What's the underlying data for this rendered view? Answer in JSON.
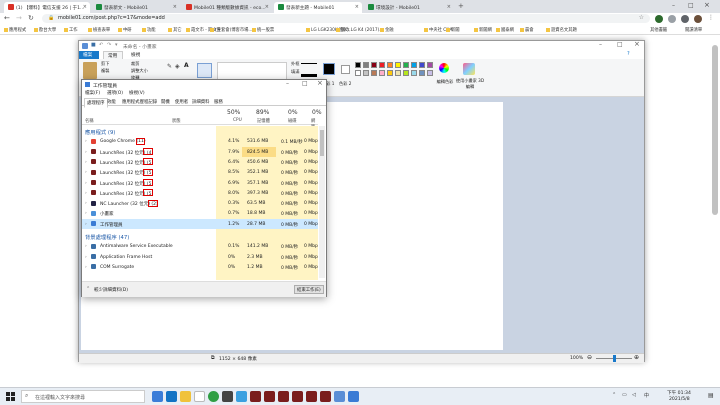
{
  "browser": {
    "tabs": [
      {
        "label": "(1) 【爆料】電信支援 26 | 于1...",
        "color": "#d93025"
      },
      {
        "label": "發表新文 - Mobile01",
        "color": "#1a8a3e"
      },
      {
        "label": "Mobile01 種類版數據資訊 - eco...",
        "color": "#d93025"
      },
      {
        "label": "發表新主題 - Mobile01",
        "color": "#1a8a3e"
      },
      {
        "label": "環境設計 - Mobile01",
        "color": "#1a8a3e"
      }
    ],
    "new_tab": "+",
    "url": "mobile01.com/post.php?c=17&mode=add",
    "bookmarks": [
      "應用程式",
      "歐台大學",
      "工作",
      "檢查表單",
      "中研",
      "功能",
      "其它",
      "霞文市 - 期文件",
      "(五套會)博客市場...",
      "統一股票",
      "LG LGK230K 進入...",
      "購改 LG K4 (2017)...",
      "金融",
      "中央社 CNA",
      "新聞",
      "新聞網",
      "國泰網",
      "晨會",
      "遊資名文其題"
    ],
    "other_bookmarks": "其他書籤",
    "reading_list": "閱讀清單"
  },
  "paint": {
    "title": "未命名 - 小畫家",
    "menu_file": "檔案",
    "menu_home": "常用",
    "menu_view": "檢視",
    "ribbon": {
      "cut": "剪下",
      "copy": "複製",
      "paste": "貼上",
      "select": "選取",
      "crop": "裁剪",
      "resize": "調整大小",
      "rotate": "旋轉",
      "brushes": "筆刷",
      "shapes_outline": "外框",
      "shapes_fill": "填滿",
      "size": "大小",
      "color1": "色彩 1",
      "color2": "色彩 2",
      "edit_colors": "編輯色彩",
      "paint3d": "使用小畫家 3D 編輯",
      "group_clipboard": "剪貼簿",
      "group_image": "影像",
      "group_tools": "工具",
      "group_shapes": "圖形",
      "group_colors": "色彩"
    },
    "palette": [
      "#000000",
      "#7f7f7f",
      "#880015",
      "#ed1c24",
      "#ff7f27",
      "#fff200",
      "#22b14c",
      "#00a2e8",
      "#3f48cc",
      "#a349a4",
      "#ffffff",
      "#c3c3c3",
      "#b97a57",
      "#ffaec9",
      "#ffc90e",
      "#efe4b0",
      "#b5e61d",
      "#99d9ea",
      "#7092be",
      "#c8bfe7"
    ],
    "status_size": "1152 × 648 像素",
    "zoom": "100%",
    "zoom_fraction": 0.5
  },
  "task_manager": {
    "title": "工作管理員",
    "menus": [
      "檔案(F)",
      "選項(O)",
      "檢視(V)"
    ],
    "tabs": [
      "處理程序",
      "效能",
      "應用程式歷程記錄",
      "開機",
      "使用者",
      "詳細資料",
      "服務"
    ],
    "columns": {
      "name": "名稱",
      "status": "狀態",
      "cpu_pct": "50%",
      "cpu": "CPU",
      "mem_pct": "89%",
      "mem": "記憶體",
      "disk_pct": "0%",
      "disk": "磁碟",
      "net_pct": "0%",
      "net": "網路"
    },
    "apps_header": "應用程式 (9)",
    "apps": [
      {
        "name": "Google Chrome (11)",
        "cpu": "4.1%",
        "mem": "531.6 MB",
        "disk": "0.1 MB/秒",
        "net": "0 Mbps",
        "icon": "#e34133",
        "boxed": true
      },
      {
        "name": "LaunchRes (32 位元) (4)",
        "cpu": "7.9%",
        "mem": "824.5 MB",
        "disk": "0 MB/秒",
        "net": "0 Mbps",
        "icon": "#7a1d1d",
        "boxed": true
      },
      {
        "name": "LaunchRes (32 位元) (5)",
        "cpu": "6.4%",
        "mem": "450.6 MB",
        "disk": "0 MB/秒",
        "net": "0 Mbps",
        "icon": "#7a1d1d",
        "boxed": true
      },
      {
        "name": "LaunchRes (32 位元) (5)",
        "cpu": "8.5%",
        "mem": "352.1 MB",
        "disk": "0 MB/秒",
        "net": "0 Mbps",
        "icon": "#7a1d1d",
        "boxed": true
      },
      {
        "name": "LaunchRes (32 位元) (5)",
        "cpu": "6.9%",
        "mem": "357.1 MB",
        "disk": "0 MB/秒",
        "net": "0 Mbps",
        "icon": "#7a1d1d",
        "boxed": true
      },
      {
        "name": "LaunchRes (32 位元) (5)",
        "cpu": "8.0%",
        "mem": "397.3 MB",
        "disk": "0 MB/秒",
        "net": "0 Mbps",
        "icon": "#7a1d1d",
        "boxed": true
      },
      {
        "name": "NC Launcher (32 位元) (2)",
        "cpu": "0.3%",
        "mem": "63.5 MB",
        "disk": "0 MB/秒",
        "net": "0 Mbps",
        "icon": "#222244",
        "boxed": true
      },
      {
        "name": "小畫家",
        "cpu": "0.7%",
        "mem": "18.8 MB",
        "disk": "0 MB/秒",
        "net": "0 Mbps",
        "icon": "#4a90d9",
        "boxed": false
      },
      {
        "name": "工作管理員",
        "cpu": "1.2%",
        "mem": "28.7 MB",
        "disk": "0 MB/秒",
        "net": "0 Mbps",
        "icon": "#3a7bd5",
        "boxed": false
      }
    ],
    "bg_header": "背景處理程序 (47)",
    "bg": [
      {
        "name": "Antimalware Service Executable",
        "cpu": "0.1%",
        "mem": "141.2 MB",
        "disk": "0 MB/秒",
        "net": "0 Mbps",
        "icon": "#3a6ea5"
      },
      {
        "name": "Application Frame Host",
        "cpu": "0%",
        "mem": "2.3 MB",
        "disk": "0 MB/秒",
        "net": "0 Mbps",
        "icon": "#3a6ea5"
      },
      {
        "name": "COM Surrogate",
        "cpu": "0%",
        "mem": "1.2 MB",
        "disk": "0 MB/秒",
        "net": "0 Mbps",
        "icon": "#3a6ea5"
      }
    ],
    "fewer_details": "較少詳細資料(D)",
    "end_task": "結束工作(E)"
  },
  "taskbar": {
    "search_placeholder": "在這裡輸入文字來搜尋",
    "time": "下午 01:34",
    "date": "2021/5/8",
    "lang": "中"
  }
}
